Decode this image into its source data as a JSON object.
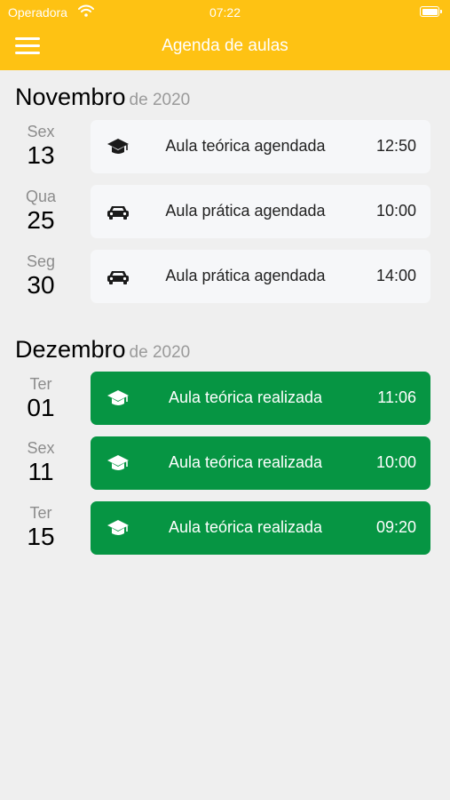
{
  "status_bar": {
    "carrier": "Operadora",
    "time": "07:22"
  },
  "header": {
    "title": "Agenda de aulas"
  },
  "months": [
    {
      "name": "Novembro",
      "year": "de 2020",
      "items": [
        {
          "weekday": "Sex",
          "day": "13",
          "icon": "graduation-cap-icon",
          "label": "Aula teórica agendada",
          "time": "12:50",
          "status": "pending"
        },
        {
          "weekday": "Qua",
          "day": "25",
          "icon": "car-icon",
          "label": "Aula prática agendada",
          "time": "10:00",
          "status": "pending"
        },
        {
          "weekday": "Seg",
          "day": "30",
          "icon": "car-icon",
          "label": "Aula prática agendada",
          "time": "14:00",
          "status": "pending"
        }
      ]
    },
    {
      "name": "Dezembro",
      "year": "de 2020",
      "items": [
        {
          "weekday": "Ter",
          "day": "01",
          "icon": "graduation-cap-icon",
          "label": "Aula teórica realizada",
          "time": "11:06",
          "status": "done"
        },
        {
          "weekday": "Sex",
          "day": "11",
          "icon": "graduation-cap-icon",
          "label": "Aula teórica realizada",
          "time": "10:00",
          "status": "done"
        },
        {
          "weekday": "Ter",
          "day": "15",
          "icon": "graduation-cap-icon",
          "label": "Aula teórica realizada",
          "time": "09:20",
          "status": "done"
        }
      ]
    }
  ],
  "colors": {
    "header": "#fec213",
    "done_card": "#069543",
    "pending_card": "#f6f7f9",
    "background": "#efefef"
  }
}
